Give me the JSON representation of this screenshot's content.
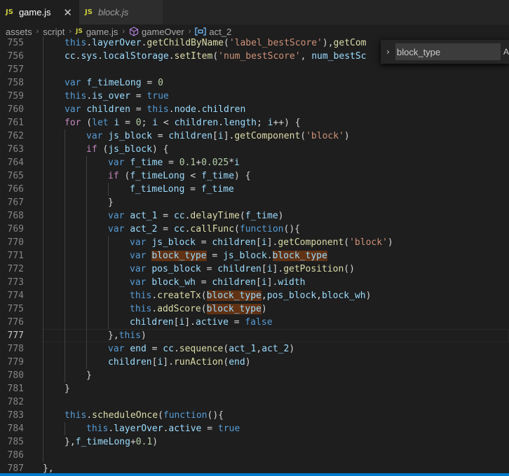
{
  "tabs": [
    {
      "badge": "JS",
      "label": "game.js",
      "close": "✕",
      "active": true
    },
    {
      "badge": "JS",
      "label": "block.js",
      "active": false
    }
  ],
  "breadcrumb": {
    "parts": [
      "assets",
      "script",
      "game.js",
      "gameOver",
      "act_2"
    ],
    "file_badge": "JS",
    "separator": "›"
  },
  "find_widget": {
    "chevron": "›",
    "value": "block_type",
    "option_label": "A"
  },
  "colors": {
    "keyword": "#569cd6",
    "control": "#c586c0",
    "variable": "#9cdcfe",
    "function": "#dcdcaa",
    "string": "#ce9178",
    "number": "#b5cea8",
    "match_highlight": "#613214",
    "status_bar": "#007acc"
  },
  "icons": {
    "method": "cube-icon",
    "variable": "variable-icon"
  },
  "current_line": 777,
  "editor": {
    "lines": [
      {
        "n": "755",
        "indent": 2,
        "tokens": [
          [
            "kw",
            "this"
          ],
          [
            "pl",
            "."
          ],
          [
            "vr",
            "layerOver"
          ],
          [
            "pl",
            "."
          ],
          [
            "fn",
            "getChildByName"
          ],
          [
            "pl",
            "("
          ],
          [
            "st",
            "'label_bestScore'"
          ],
          [
            "pl",
            "),"
          ],
          [
            "fn",
            "getCom"
          ]
        ]
      },
      {
        "n": "756",
        "indent": 2,
        "tokens": [
          [
            "vr",
            "cc"
          ],
          [
            "pl",
            "."
          ],
          [
            "vr",
            "sys"
          ],
          [
            "pl",
            "."
          ],
          [
            "vr",
            "localStorage"
          ],
          [
            "pl",
            "."
          ],
          [
            "fn",
            "setItem"
          ],
          [
            "pl",
            "("
          ],
          [
            "st",
            "'num_bestScore'"
          ],
          [
            "pl",
            ", "
          ],
          [
            "vr",
            "num_bestSc"
          ]
        ]
      },
      {
        "n": "757",
        "indent": 2,
        "tokens": []
      },
      {
        "n": "758",
        "indent": 2,
        "tokens": [
          [
            "kw",
            "var "
          ],
          [
            "vr",
            "f_timeLong"
          ],
          [
            "pl",
            " = "
          ],
          [
            "nm",
            "0"
          ]
        ]
      },
      {
        "n": "759",
        "indent": 2,
        "tokens": [
          [
            "kw",
            "this"
          ],
          [
            "pl",
            "."
          ],
          [
            "vr",
            "is_over"
          ],
          [
            "pl",
            " = "
          ],
          [
            "kw",
            "true"
          ]
        ]
      },
      {
        "n": "760",
        "indent": 2,
        "tokens": [
          [
            "kw",
            "var "
          ],
          [
            "vr",
            "children"
          ],
          [
            "pl",
            " = "
          ],
          [
            "kw",
            "this"
          ],
          [
            "pl",
            "."
          ],
          [
            "vr",
            "node"
          ],
          [
            "pl",
            "."
          ],
          [
            "vr",
            "children"
          ]
        ]
      },
      {
        "n": "761",
        "indent": 2,
        "tokens": [
          [
            "ctl",
            "for"
          ],
          [
            "pl",
            " ("
          ],
          [
            "kw",
            "let "
          ],
          [
            "vr",
            "i"
          ],
          [
            "pl",
            " = "
          ],
          [
            "nm",
            "0"
          ],
          [
            "pl",
            "; "
          ],
          [
            "vr",
            "i"
          ],
          [
            "pl",
            " < "
          ],
          [
            "vr",
            "children"
          ],
          [
            "pl",
            "."
          ],
          [
            "vr",
            "length"
          ],
          [
            "pl",
            "; "
          ],
          [
            "vr",
            "i"
          ],
          [
            "pl",
            "++) {"
          ]
        ]
      },
      {
        "n": "762",
        "indent": 3,
        "tokens": [
          [
            "kw",
            "var "
          ],
          [
            "vr",
            "js_block"
          ],
          [
            "pl",
            " = "
          ],
          [
            "vr",
            "children"
          ],
          [
            "pl",
            "["
          ],
          [
            "vr",
            "i"
          ],
          [
            "pl",
            "]."
          ],
          [
            "fn",
            "getComponent"
          ],
          [
            "pl",
            "("
          ],
          [
            "st",
            "'block'"
          ],
          [
            "pl",
            ")"
          ]
        ]
      },
      {
        "n": "763",
        "indent": 3,
        "tokens": [
          [
            "ctl",
            "if"
          ],
          [
            "pl",
            " ("
          ],
          [
            "vr",
            "js_block"
          ],
          [
            "pl",
            ") {"
          ]
        ]
      },
      {
        "n": "764",
        "indent": 4,
        "tokens": [
          [
            "kw",
            "var "
          ],
          [
            "vr",
            "f_time"
          ],
          [
            "pl",
            " = "
          ],
          [
            "nm",
            "0.1"
          ],
          [
            "pl",
            "+"
          ],
          [
            "nm",
            "0.025"
          ],
          [
            "pl",
            "*"
          ],
          [
            "vr",
            "i"
          ]
        ]
      },
      {
        "n": "765",
        "indent": 4,
        "tokens": [
          [
            "ctl",
            "if"
          ],
          [
            "pl",
            " ("
          ],
          [
            "vr",
            "f_timeLong"
          ],
          [
            "pl",
            " < "
          ],
          [
            "vr",
            "f_time"
          ],
          [
            "pl",
            ") {"
          ]
        ]
      },
      {
        "n": "766",
        "indent": 5,
        "tokens": [
          [
            "vr",
            "f_timeLong"
          ],
          [
            "pl",
            " = "
          ],
          [
            "vr",
            "f_time"
          ]
        ]
      },
      {
        "n": "767",
        "indent": 4,
        "tokens": [
          [
            "pl",
            "}"
          ]
        ]
      },
      {
        "n": "768",
        "indent": 4,
        "tokens": [
          [
            "kw",
            "var "
          ],
          [
            "vr",
            "act_1"
          ],
          [
            "pl",
            " = "
          ],
          [
            "vr",
            "cc"
          ],
          [
            "pl",
            "."
          ],
          [
            "fn",
            "delayTime"
          ],
          [
            "pl",
            "("
          ],
          [
            "vr",
            "f_time"
          ],
          [
            "pl",
            ")"
          ]
        ]
      },
      {
        "n": "769",
        "indent": 4,
        "tokens": [
          [
            "kw",
            "var "
          ],
          [
            "vr",
            "act_2"
          ],
          [
            "pl",
            " = "
          ],
          [
            "vr",
            "cc"
          ],
          [
            "pl",
            "."
          ],
          [
            "fn",
            "callFunc"
          ],
          [
            "pl",
            "("
          ],
          [
            "kw",
            "function"
          ],
          [
            "pl",
            "(){"
          ]
        ]
      },
      {
        "n": "770",
        "indent": 5,
        "tokens": [
          [
            "kw",
            "var "
          ],
          [
            "vr",
            "js_block"
          ],
          [
            "pl",
            " = "
          ],
          [
            "vr",
            "children"
          ],
          [
            "pl",
            "["
          ],
          [
            "vr",
            "i"
          ],
          [
            "pl",
            "]."
          ],
          [
            "fn",
            "getComponent"
          ],
          [
            "pl",
            "("
          ],
          [
            "st",
            "'block'"
          ],
          [
            "pl",
            ")"
          ]
        ]
      },
      {
        "n": "771",
        "indent": 5,
        "tokens": [
          [
            "kw",
            "var "
          ],
          [
            "vr hl",
            "block_type"
          ],
          [
            "pl",
            " = "
          ],
          [
            "vr",
            "js_block"
          ],
          [
            "pl",
            "."
          ],
          [
            "vr hl",
            "block_type"
          ]
        ]
      },
      {
        "n": "772",
        "indent": 5,
        "tokens": [
          [
            "kw",
            "var "
          ],
          [
            "vr",
            "pos_block"
          ],
          [
            "pl",
            " = "
          ],
          [
            "vr",
            "children"
          ],
          [
            "pl",
            "["
          ],
          [
            "vr",
            "i"
          ],
          [
            "pl",
            "]."
          ],
          [
            "fn",
            "getPosition"
          ],
          [
            "pl",
            "()"
          ]
        ]
      },
      {
        "n": "773",
        "indent": 5,
        "tokens": [
          [
            "kw",
            "var "
          ],
          [
            "vr",
            "block_wh"
          ],
          [
            "pl",
            " = "
          ],
          [
            "vr",
            "children"
          ],
          [
            "pl",
            "["
          ],
          [
            "vr",
            "i"
          ],
          [
            "pl",
            "]."
          ],
          [
            "vr",
            "width"
          ]
        ]
      },
      {
        "n": "774",
        "indent": 5,
        "tokens": [
          [
            "kw",
            "this"
          ],
          [
            "pl",
            "."
          ],
          [
            "fn",
            "createTx"
          ],
          [
            "pl",
            "("
          ],
          [
            "vr hl",
            "block_type"
          ],
          [
            "pl",
            ","
          ],
          [
            "vr",
            "pos_block"
          ],
          [
            "pl",
            ","
          ],
          [
            "vr",
            "block_wh"
          ],
          [
            "pl",
            ")"
          ]
        ]
      },
      {
        "n": "775",
        "indent": 5,
        "tokens": [
          [
            "kw",
            "this"
          ],
          [
            "pl",
            "."
          ],
          [
            "fn",
            "addScore"
          ],
          [
            "pl",
            "("
          ],
          [
            "vr hl",
            "block_type"
          ],
          [
            "pl",
            ")"
          ]
        ]
      },
      {
        "n": "776",
        "indent": 5,
        "tokens": [
          [
            "vr",
            "children"
          ],
          [
            "pl",
            "["
          ],
          [
            "vr",
            "i"
          ],
          [
            "pl",
            "]."
          ],
          [
            "vr",
            "active"
          ],
          [
            "pl",
            " = "
          ],
          [
            "kw",
            "false"
          ]
        ]
      },
      {
        "n": "777",
        "indent": 4,
        "tokens": [
          [
            "pl",
            "},"
          ],
          [
            "kw",
            "this"
          ],
          [
            "pl",
            ")"
          ]
        ]
      },
      {
        "n": "778",
        "indent": 4,
        "tokens": [
          [
            "kw",
            "var "
          ],
          [
            "vr",
            "end"
          ],
          [
            "pl",
            " = "
          ],
          [
            "vr",
            "cc"
          ],
          [
            "pl",
            "."
          ],
          [
            "fn",
            "sequence"
          ],
          [
            "pl",
            "("
          ],
          [
            "vr",
            "act_1"
          ],
          [
            "pl",
            ","
          ],
          [
            "vr",
            "act_2"
          ],
          [
            "pl",
            ")"
          ]
        ]
      },
      {
        "n": "779",
        "indent": 4,
        "tokens": [
          [
            "vr",
            "children"
          ],
          [
            "pl",
            "["
          ],
          [
            "vr",
            "i"
          ],
          [
            "pl",
            "]."
          ],
          [
            "fn",
            "runAction"
          ],
          [
            "pl",
            "("
          ],
          [
            "vr",
            "end"
          ],
          [
            "pl",
            ")"
          ]
        ]
      },
      {
        "n": "780",
        "indent": 3,
        "tokens": [
          [
            "pl",
            "}"
          ]
        ]
      },
      {
        "n": "781",
        "indent": 2,
        "tokens": [
          [
            "pl",
            "}"
          ]
        ]
      },
      {
        "n": "782",
        "indent": 2,
        "tokens": []
      },
      {
        "n": "783",
        "indent": 2,
        "tokens": [
          [
            "kw",
            "this"
          ],
          [
            "pl",
            "."
          ],
          [
            "fn",
            "scheduleOnce"
          ],
          [
            "pl",
            "("
          ],
          [
            "kw",
            "function"
          ],
          [
            "pl",
            "(){"
          ]
        ]
      },
      {
        "n": "784",
        "indent": 3,
        "tokens": [
          [
            "kw",
            "this"
          ],
          [
            "pl",
            "."
          ],
          [
            "vr",
            "layerOver"
          ],
          [
            "pl",
            "."
          ],
          [
            "vr",
            "active"
          ],
          [
            "pl",
            " = "
          ],
          [
            "kw",
            "true"
          ]
        ]
      },
      {
        "n": "785",
        "indent": 2,
        "tokens": [
          [
            "pl",
            "},"
          ],
          [
            "vr",
            "f_timeLong"
          ],
          [
            "pl",
            "+"
          ],
          [
            "nm",
            "0.1"
          ],
          [
            "pl",
            ")"
          ]
        ]
      },
      {
        "n": "786",
        "indent": 2,
        "tokens": []
      },
      {
        "n": "787",
        "indent": 1,
        "tokens": [
          [
            "pl",
            "},"
          ]
        ]
      }
    ]
  }
}
